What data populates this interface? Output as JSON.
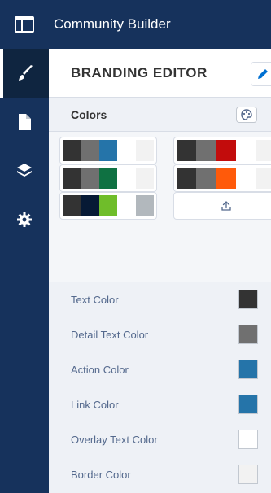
{
  "app": {
    "title": "Community Builder"
  },
  "rail": {
    "items": [
      "brush-icon",
      "page-icon",
      "layers-icon",
      "settings-icon"
    ]
  },
  "panel": {
    "title": "BRANDING EDITOR"
  },
  "colors_section": {
    "title": "Colors"
  },
  "palettes": [
    {
      "colors": [
        "#333333",
        "#707070",
        "#2574a9",
        "#ffffff",
        "#f2f2f2"
      ]
    },
    {
      "colors": [
        "#333333",
        "#707070",
        "#c20c0c",
        "#ffffff",
        "#f2f2f2"
      ]
    },
    {
      "colors": [
        "#333333",
        "#707070",
        "#0f7142",
        "#ffffff",
        "#f2f2f2"
      ]
    },
    {
      "colors": [
        "#333333",
        "#707070",
        "#ff5a0a",
        "#ffffff",
        "#f2f2f2"
      ]
    },
    {
      "colors": [
        "#333333",
        "#071a35",
        "#6fbd2a",
        "#ffffff",
        "#b2b8bd"
      ]
    }
  ],
  "upload": {
    "icon": "upload-icon"
  },
  "color_settings": [
    {
      "label": "Text Color",
      "color": "#333333"
    },
    {
      "label": "Detail Text Color",
      "color": "#707070"
    },
    {
      "label": "Action Color",
      "color": "#2574a9"
    },
    {
      "label": "Link Color",
      "color": "#2574a9"
    },
    {
      "label": "Overlay Text Color",
      "color": "#ffffff"
    },
    {
      "label": "Border Color",
      "color": "#f2f2f2"
    }
  ]
}
